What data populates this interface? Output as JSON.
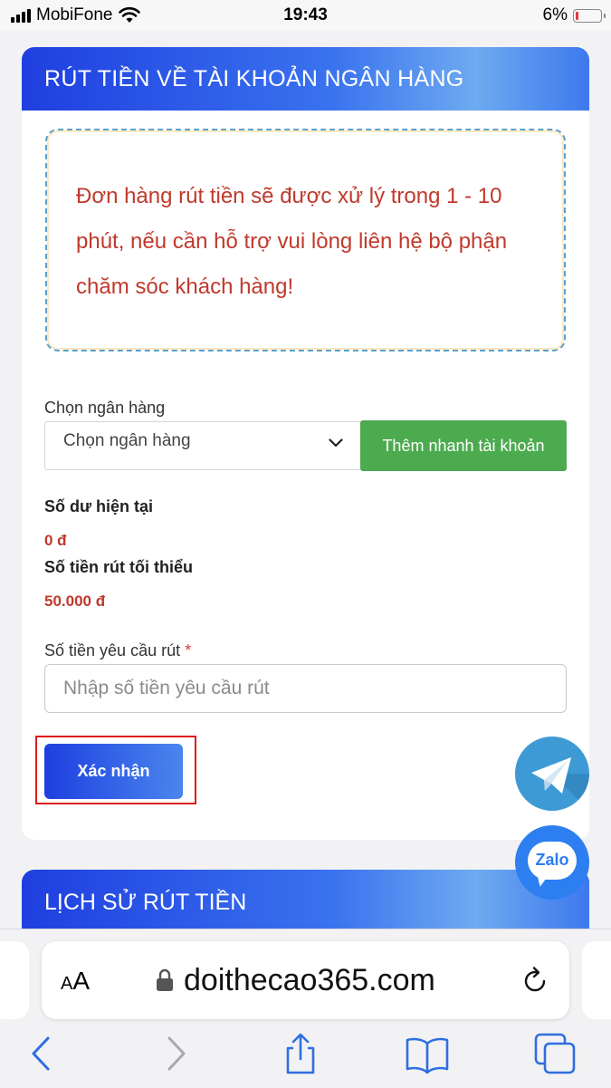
{
  "status_bar": {
    "carrier": "MobiFone",
    "time": "19:43",
    "battery": "6%"
  },
  "withdraw": {
    "title": "RÚT TIỀN VỀ TÀI KHOẢN NGÂN HÀNG",
    "notice": "Đơn hàng rút tiền sẽ được xử lý trong 1 - 10 phút, nếu cần hỗ trợ vui lòng liên hệ bộ phận chăm sóc khách hàng!",
    "bank_label": "Chọn ngân hàng",
    "bank_select_value": "Chọn ngân hàng",
    "quick_add_button": "Thêm nhanh tài khoản",
    "balance_label": "Số dư hiện tại",
    "balance_value": "0 đ",
    "min_label": "Số tiền rút tối thiểu",
    "min_value": "50.000 đ",
    "amount_label": "Số tiền yêu cầu rút",
    "required_mark": "*",
    "amount_placeholder": "Nhập số tiền yêu cầu rút",
    "confirm_button": "Xác nhận"
  },
  "history": {
    "title": "LỊCH SỬ RÚT TIỀN"
  },
  "floating": {
    "zalo_label": "Zalo"
  },
  "browser": {
    "aa_small": "A",
    "aa_big": "A",
    "domain": "doithecao365.com"
  },
  "colors": {
    "header_blue": "#1f3fe0",
    "notice_red": "#c0392b",
    "add_green": "#4caa4f",
    "highlight_red": "#e01b1b"
  },
  "icons": [
    "signal-icon",
    "wifi-icon",
    "battery-icon",
    "chevron-down-icon",
    "telegram-icon",
    "zalo-icon",
    "lock-icon",
    "reload-icon",
    "back-icon",
    "forward-icon",
    "share-icon",
    "bookmarks-icon",
    "tabs-icon"
  ]
}
